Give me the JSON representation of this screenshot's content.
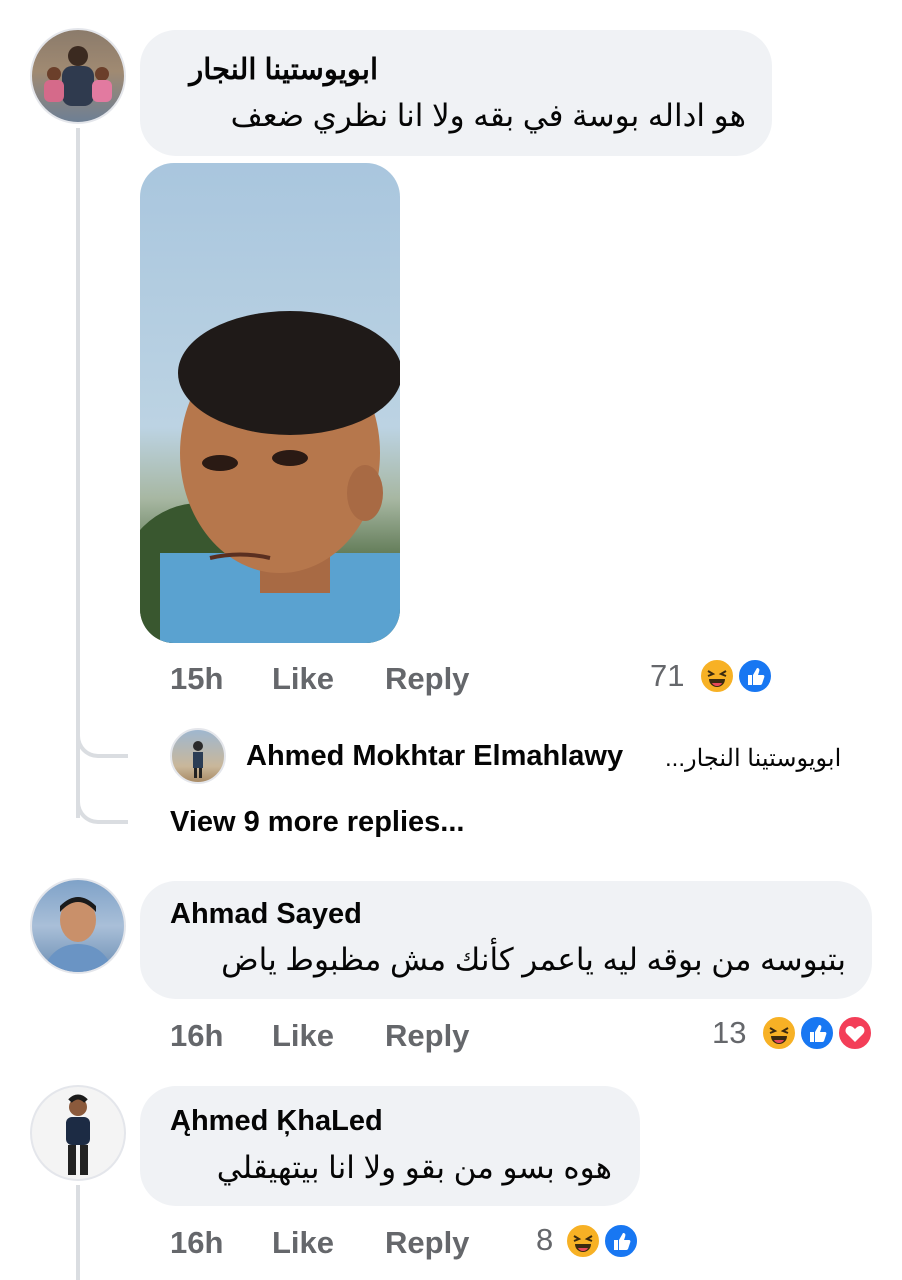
{
  "comments": [
    {
      "author": "ابويوستينا النجار",
      "text": "هو اداله بوسة  في بقه ولا انا  نظري ضعف",
      "time": "15h",
      "like": "Like",
      "reply": "Reply",
      "reaction_count": "71",
      "reactions": [
        "haha-icon",
        "like-icon"
      ]
    },
    {
      "author": "Ahmad Sayed",
      "text": "بتبوسه من بوقه ليه ياعمر كأنك مش مظبوط ياض",
      "time": "16h",
      "like": "Like",
      "reply": "Reply",
      "reaction_count": "13",
      "reactions": [
        "haha-icon",
        "like-icon",
        "love-icon"
      ]
    },
    {
      "author": "Ąhmed ĶhaLed",
      "text": "هوه بسو من بقو ولا انا بيتهيقلي",
      "time": "16h",
      "like": "Like",
      "reply": "Reply",
      "reaction_count": "8",
      "reactions": [
        "haha-icon",
        "like-icon"
      ]
    }
  ],
  "reply_preview": {
    "author": "Ahmed Mokhtar Elmahlawy",
    "mention": "ابويوستينا النجار..."
  },
  "view_more": "View 9 more replies..."
}
